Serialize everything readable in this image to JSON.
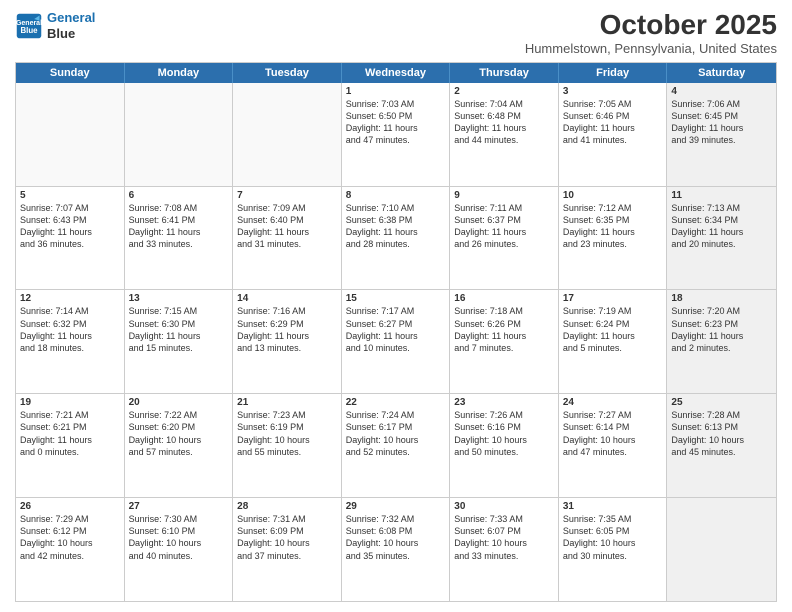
{
  "header": {
    "logo_line1": "General",
    "logo_line2": "Blue",
    "month": "October 2025",
    "location": "Hummelstown, Pennsylvania, United States"
  },
  "days_of_week": [
    "Sunday",
    "Monday",
    "Tuesday",
    "Wednesday",
    "Thursday",
    "Friday",
    "Saturday"
  ],
  "weeks": [
    [
      {
        "day": "",
        "text": "",
        "empty": true
      },
      {
        "day": "",
        "text": "",
        "empty": true
      },
      {
        "day": "",
        "text": "",
        "empty": true
      },
      {
        "day": "1",
        "text": "Sunrise: 7:03 AM\nSunset: 6:50 PM\nDaylight: 11 hours\nand 47 minutes.",
        "empty": false
      },
      {
        "day": "2",
        "text": "Sunrise: 7:04 AM\nSunset: 6:48 PM\nDaylight: 11 hours\nand 44 minutes.",
        "empty": false
      },
      {
        "day": "3",
        "text": "Sunrise: 7:05 AM\nSunset: 6:46 PM\nDaylight: 11 hours\nand 41 minutes.",
        "empty": false
      },
      {
        "day": "4",
        "text": "Sunrise: 7:06 AM\nSunset: 6:45 PM\nDaylight: 11 hours\nand 39 minutes.",
        "empty": false,
        "shaded": true
      }
    ],
    [
      {
        "day": "5",
        "text": "Sunrise: 7:07 AM\nSunset: 6:43 PM\nDaylight: 11 hours\nand 36 minutes.",
        "empty": false
      },
      {
        "day": "6",
        "text": "Sunrise: 7:08 AM\nSunset: 6:41 PM\nDaylight: 11 hours\nand 33 minutes.",
        "empty": false
      },
      {
        "day": "7",
        "text": "Sunrise: 7:09 AM\nSunset: 6:40 PM\nDaylight: 11 hours\nand 31 minutes.",
        "empty": false
      },
      {
        "day": "8",
        "text": "Sunrise: 7:10 AM\nSunset: 6:38 PM\nDaylight: 11 hours\nand 28 minutes.",
        "empty": false
      },
      {
        "day": "9",
        "text": "Sunrise: 7:11 AM\nSunset: 6:37 PM\nDaylight: 11 hours\nand 26 minutes.",
        "empty": false
      },
      {
        "day": "10",
        "text": "Sunrise: 7:12 AM\nSunset: 6:35 PM\nDaylight: 11 hours\nand 23 minutes.",
        "empty": false
      },
      {
        "day": "11",
        "text": "Sunrise: 7:13 AM\nSunset: 6:34 PM\nDaylight: 11 hours\nand 20 minutes.",
        "empty": false,
        "shaded": true
      }
    ],
    [
      {
        "day": "12",
        "text": "Sunrise: 7:14 AM\nSunset: 6:32 PM\nDaylight: 11 hours\nand 18 minutes.",
        "empty": false
      },
      {
        "day": "13",
        "text": "Sunrise: 7:15 AM\nSunset: 6:30 PM\nDaylight: 11 hours\nand 15 minutes.",
        "empty": false
      },
      {
        "day": "14",
        "text": "Sunrise: 7:16 AM\nSunset: 6:29 PM\nDaylight: 11 hours\nand 13 minutes.",
        "empty": false
      },
      {
        "day": "15",
        "text": "Sunrise: 7:17 AM\nSunset: 6:27 PM\nDaylight: 11 hours\nand 10 minutes.",
        "empty": false
      },
      {
        "day": "16",
        "text": "Sunrise: 7:18 AM\nSunset: 6:26 PM\nDaylight: 11 hours\nand 7 minutes.",
        "empty": false
      },
      {
        "day": "17",
        "text": "Sunrise: 7:19 AM\nSunset: 6:24 PM\nDaylight: 11 hours\nand 5 minutes.",
        "empty": false
      },
      {
        "day": "18",
        "text": "Sunrise: 7:20 AM\nSunset: 6:23 PM\nDaylight: 11 hours\nand 2 minutes.",
        "empty": false,
        "shaded": true
      }
    ],
    [
      {
        "day": "19",
        "text": "Sunrise: 7:21 AM\nSunset: 6:21 PM\nDaylight: 11 hours\nand 0 minutes.",
        "empty": false
      },
      {
        "day": "20",
        "text": "Sunrise: 7:22 AM\nSunset: 6:20 PM\nDaylight: 10 hours\nand 57 minutes.",
        "empty": false
      },
      {
        "day": "21",
        "text": "Sunrise: 7:23 AM\nSunset: 6:19 PM\nDaylight: 10 hours\nand 55 minutes.",
        "empty": false
      },
      {
        "day": "22",
        "text": "Sunrise: 7:24 AM\nSunset: 6:17 PM\nDaylight: 10 hours\nand 52 minutes.",
        "empty": false
      },
      {
        "day": "23",
        "text": "Sunrise: 7:26 AM\nSunset: 6:16 PM\nDaylight: 10 hours\nand 50 minutes.",
        "empty": false
      },
      {
        "day": "24",
        "text": "Sunrise: 7:27 AM\nSunset: 6:14 PM\nDaylight: 10 hours\nand 47 minutes.",
        "empty": false
      },
      {
        "day": "25",
        "text": "Sunrise: 7:28 AM\nSunset: 6:13 PM\nDaylight: 10 hours\nand 45 minutes.",
        "empty": false,
        "shaded": true
      }
    ],
    [
      {
        "day": "26",
        "text": "Sunrise: 7:29 AM\nSunset: 6:12 PM\nDaylight: 10 hours\nand 42 minutes.",
        "empty": false
      },
      {
        "day": "27",
        "text": "Sunrise: 7:30 AM\nSunset: 6:10 PM\nDaylight: 10 hours\nand 40 minutes.",
        "empty": false
      },
      {
        "day": "28",
        "text": "Sunrise: 7:31 AM\nSunset: 6:09 PM\nDaylight: 10 hours\nand 37 minutes.",
        "empty": false
      },
      {
        "day": "29",
        "text": "Sunrise: 7:32 AM\nSunset: 6:08 PM\nDaylight: 10 hours\nand 35 minutes.",
        "empty": false
      },
      {
        "day": "30",
        "text": "Sunrise: 7:33 AM\nSunset: 6:07 PM\nDaylight: 10 hours\nand 33 minutes.",
        "empty": false
      },
      {
        "day": "31",
        "text": "Sunrise: 7:35 AM\nSunset: 6:05 PM\nDaylight: 10 hours\nand 30 minutes.",
        "empty": false
      },
      {
        "day": "",
        "text": "",
        "empty": true,
        "shaded": true
      }
    ]
  ]
}
